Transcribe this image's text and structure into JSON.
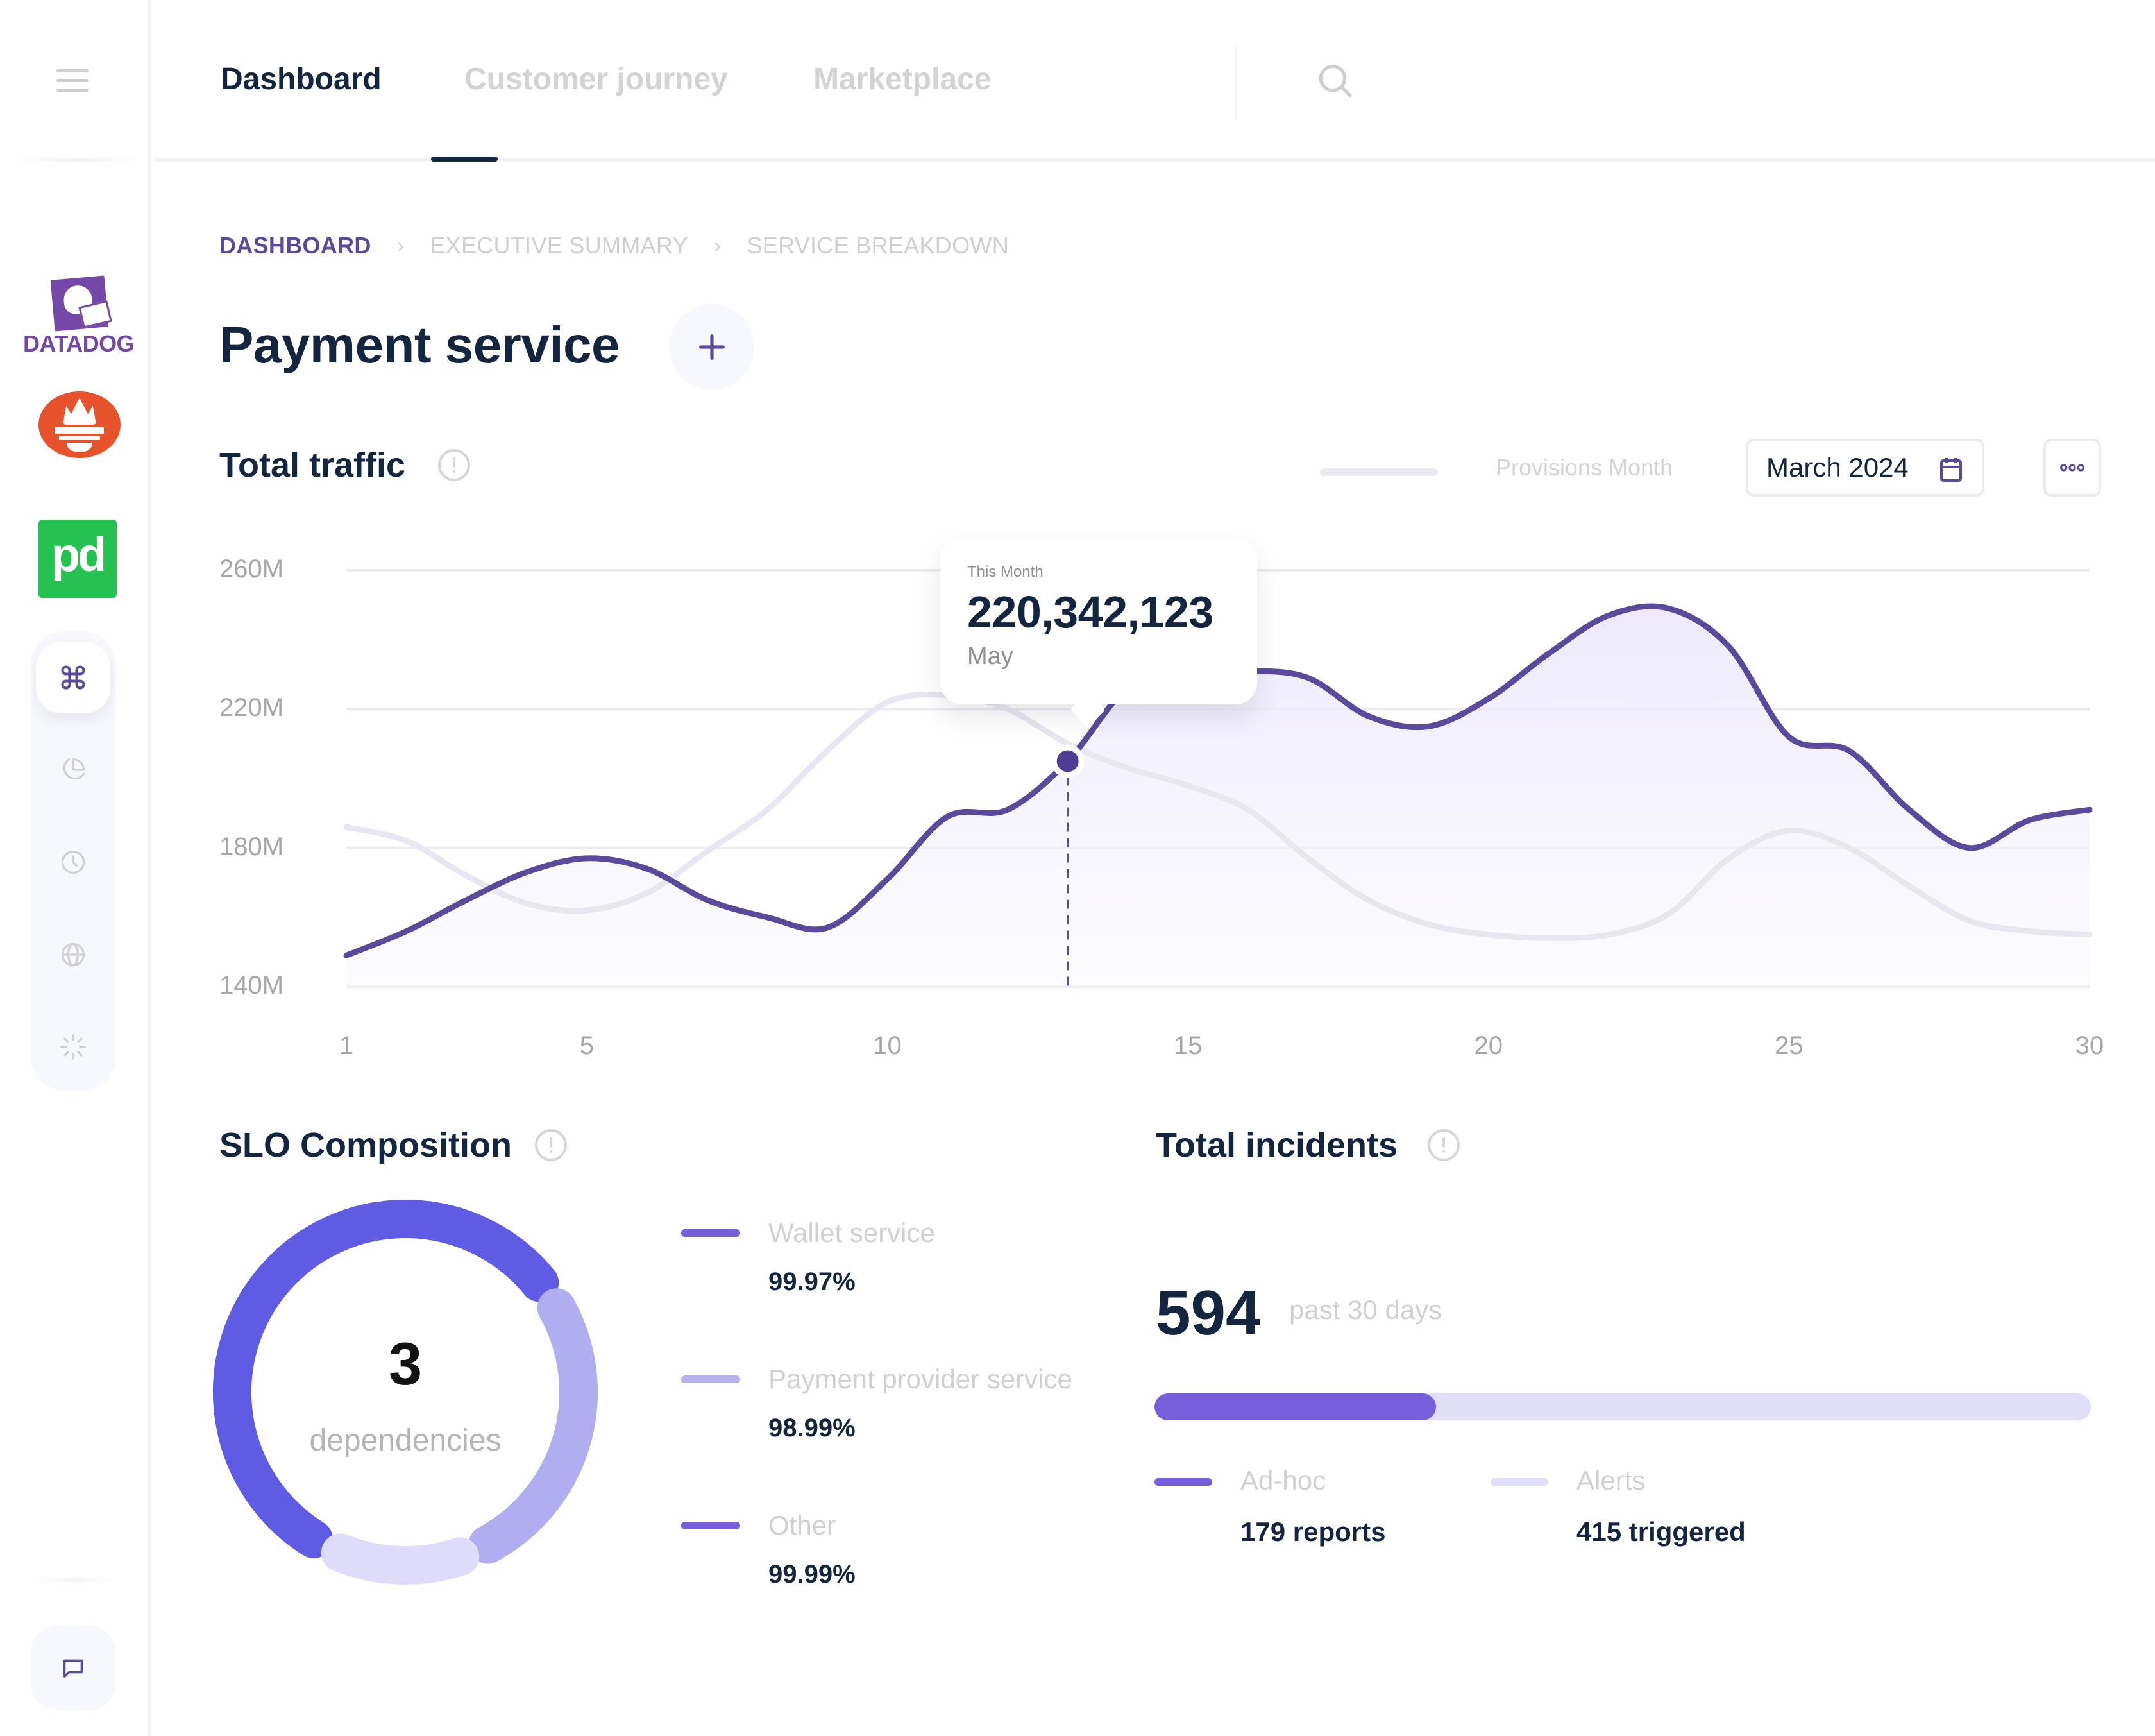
{
  "sidebar": {
    "menu_icon": "hamburger-icon",
    "integrations": [
      {
        "name": "Datadog",
        "label": "DATADOG",
        "color": "#7447a8"
      },
      {
        "name": "Prometheus",
        "color": "#e6522c"
      },
      {
        "name": "PagerDuty",
        "label": "pd",
        "color": "#25c151"
      }
    ],
    "nav_items": [
      {
        "icon": "command-icon",
        "active": true
      },
      {
        "icon": "pie-chart-icon",
        "active": false
      },
      {
        "icon": "clock-icon",
        "active": false
      },
      {
        "icon": "globe-icon",
        "active": false
      },
      {
        "icon": "loader-icon",
        "active": false
      }
    ],
    "chat_icon": "chat-bubble-icon"
  },
  "header": {
    "tabs": [
      {
        "label": "Dashboard",
        "active": true
      },
      {
        "label": "Customer journey",
        "active": false
      },
      {
        "label": "Marketplace",
        "active": false
      }
    ],
    "search_icon": "search-icon"
  },
  "breadcrumb": [
    "DASHBOARD",
    "EXECUTIVE SUMMARY",
    "SERVICE BREAKDOWN"
  ],
  "page": {
    "title": "Payment service",
    "add_button": "+"
  },
  "traffic": {
    "title": "Total traffic",
    "legend_label": "Provisions Month",
    "date_value": "March 2024",
    "more_label": "•••",
    "tooltip": {
      "label": "This Month",
      "value": "220,342,123",
      "sub": "May",
      "day": 13
    }
  },
  "colors": {
    "accent": "#5b4a9b",
    "primary_line": "#5b4a9b",
    "secondary_line": "#e8e6f0",
    "text_dark": "#13253f",
    "muted": "#d3d3d6"
  },
  "chart_data": {
    "type": "line",
    "title": "Total traffic",
    "xlabel": "",
    "ylabel": "",
    "x": [
      1,
      2,
      3,
      4,
      5,
      6,
      7,
      8,
      9,
      10,
      11,
      12,
      13,
      14,
      15,
      16,
      17,
      18,
      19,
      20,
      21,
      22,
      23,
      24,
      25,
      26,
      27,
      28,
      29,
      30
    ],
    "x_ticks": [
      1,
      5,
      10,
      15,
      20,
      25,
      30
    ],
    "y_ticks": [
      140,
      180,
      220,
      260
    ],
    "y_tick_labels": [
      "140M",
      "180M",
      "220M",
      "260M"
    ],
    "ylim": [
      140,
      260
    ],
    "y_unit": "M",
    "grid": true,
    "series": [
      {
        "name": "This Month",
        "color": "#5b4a9b",
        "filled": true,
        "values": [
          149,
          156,
          165,
          173,
          177,
          174,
          165,
          160,
          157,
          171,
          189,
          191,
          205,
          226,
          230,
          231,
          229,
          218,
          215,
          223,
          236,
          247,
          249,
          238,
          212,
          208,
          191,
          180,
          188,
          191
        ]
      },
      {
        "name": "Provisions Month",
        "color": "#e8e6f0",
        "filled": false,
        "values": [
          186,
          182,
          172,
          164,
          162,
          167,
          179,
          191,
          208,
          222,
          224,
          220,
          210,
          203,
          198,
          191,
          177,
          165,
          158,
          155,
          154,
          155,
          161,
          177,
          185,
          180,
          169,
          159,
          156,
          155
        ]
      }
    ],
    "highlight": {
      "series": "This Month",
      "x": 13,
      "label": "220,342,123",
      "sub": "May"
    }
  },
  "slo": {
    "title": "SLO Composition",
    "center_value": "3",
    "center_label": "dependencies",
    "items": [
      {
        "name": "Wallet service",
        "value": "99.97%",
        "color": "#775edb",
        "arc_color": "#5f5be3",
        "share": 0.58
      },
      {
        "name": "Payment provider service",
        "value": "98.99%",
        "color": "#b9b0ee",
        "arc_color": "#b0adf1",
        "share": 0.28
      },
      {
        "name": "Other",
        "value": "99.99%",
        "color": "#775edb",
        "arc_color": "#dedcf8",
        "share": 0.14
      }
    ]
  },
  "incidents": {
    "title": "Total incidents",
    "total": "594",
    "period": "past 30 days",
    "progress_fraction": 0.301,
    "legend": [
      {
        "name": "Ad-hoc",
        "value": "179 reports",
        "color": "#775edb"
      },
      {
        "name": "Alerts",
        "value": "415 triggered",
        "color": "#e1dff7"
      }
    ]
  }
}
